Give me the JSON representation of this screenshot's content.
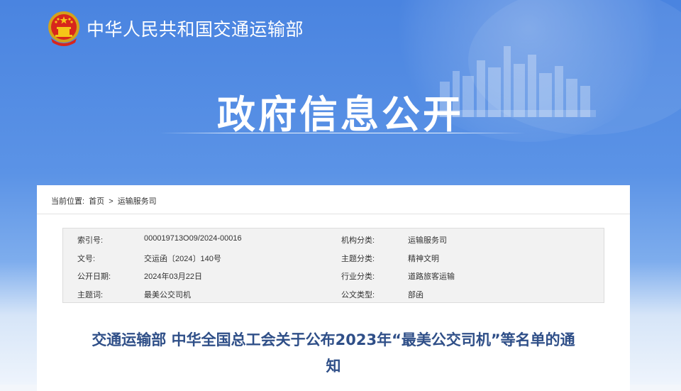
{
  "header": {
    "ministry_name": "中华人民共和国交通运输部",
    "emblem_icon": "national-emblem-icon",
    "section_title": "政府信息公开"
  },
  "breadcrumb": {
    "label": "当前位置:",
    "items": [
      "首页",
      "运输服务司"
    ],
    "separator": ">"
  },
  "meta": {
    "index_label": "索引号:",
    "index_value": "000019713O09/2024-00016",
    "org_label": "机构分类:",
    "org_value": "运输服务司",
    "docno_label": "文号:",
    "docno_value": "交运函〔2024〕140号",
    "topic_label": "主题分类:",
    "topic_value": "精神文明",
    "date_label": "公开日期:",
    "date_value": "2024年03月22日",
    "industry_label": "行业分类:",
    "industry_value": "道路旅客运输",
    "keyword_label": "主题词:",
    "keyword_value": "最美公交司机",
    "type_label": "公文类型:",
    "type_value": "部函"
  },
  "document": {
    "title_line1": "交通运输部 中华全国总工会关于公布2023年“最美公交司机”等名单的通",
    "title_line2": "知"
  },
  "colors": {
    "banner_blue": "#4a84e0",
    "title_blue": "#2f4f88"
  }
}
